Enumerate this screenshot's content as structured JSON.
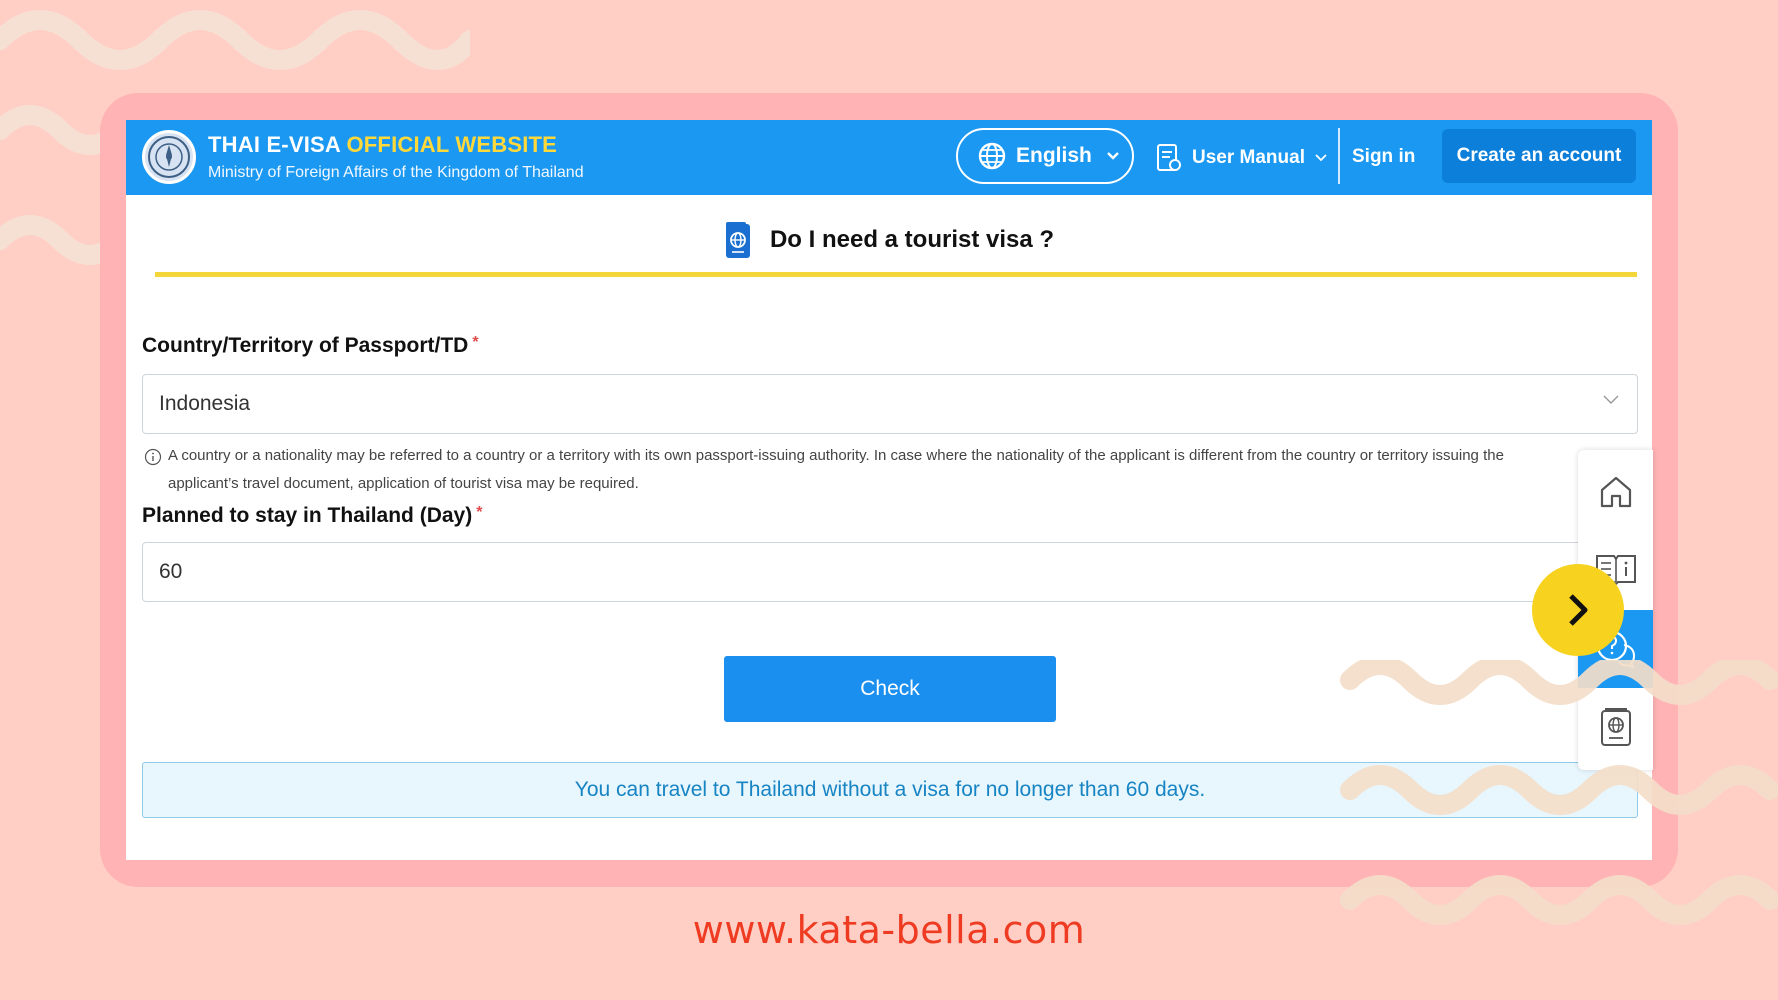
{
  "header": {
    "title_part1": "THAI E-VISA ",
    "title_part2": "OFFICIAL WEBSITE",
    "subtitle": "Ministry of Foreign Affairs of the Kingdom of Thailand",
    "language_label": "English",
    "user_manual_label": "User Manual",
    "sign_in_label": "Sign in",
    "create_account_label": "Create an account"
  },
  "page": {
    "section_title": "Do I need a tourist visa ?"
  },
  "form": {
    "country_label": "Country/Territory of Passport/TD",
    "required_mark": "*",
    "country_value": "Indonesia",
    "note_line1": "A country or a nationality may be referred to a country or a territory with its own passport-issuing authority. In case where the nationality of the applicant is different from the country or territory issuing the",
    "note_line2": "applicant’s travel document, application of tourist visa may be required.",
    "days_label": "Planned to stay in Thailand (Day)",
    "days_value": "60",
    "check_label": "Check",
    "result_text": "You can travel to Thailand without a visa for no longer than 60 days."
  },
  "side_panel": {
    "items": [
      "home-icon",
      "book-info-icon",
      "help-chat-icon",
      "passport-icon"
    ],
    "active_index": 2
  },
  "footer": {
    "website": "www.kata-bella.com"
  },
  "colors": {
    "background": "#ffcfc6",
    "frame": "#ffb3b5",
    "header_blue": "#1a98f2",
    "accent_yellow": "#f5d63a",
    "website_red": "#ee3b22"
  }
}
